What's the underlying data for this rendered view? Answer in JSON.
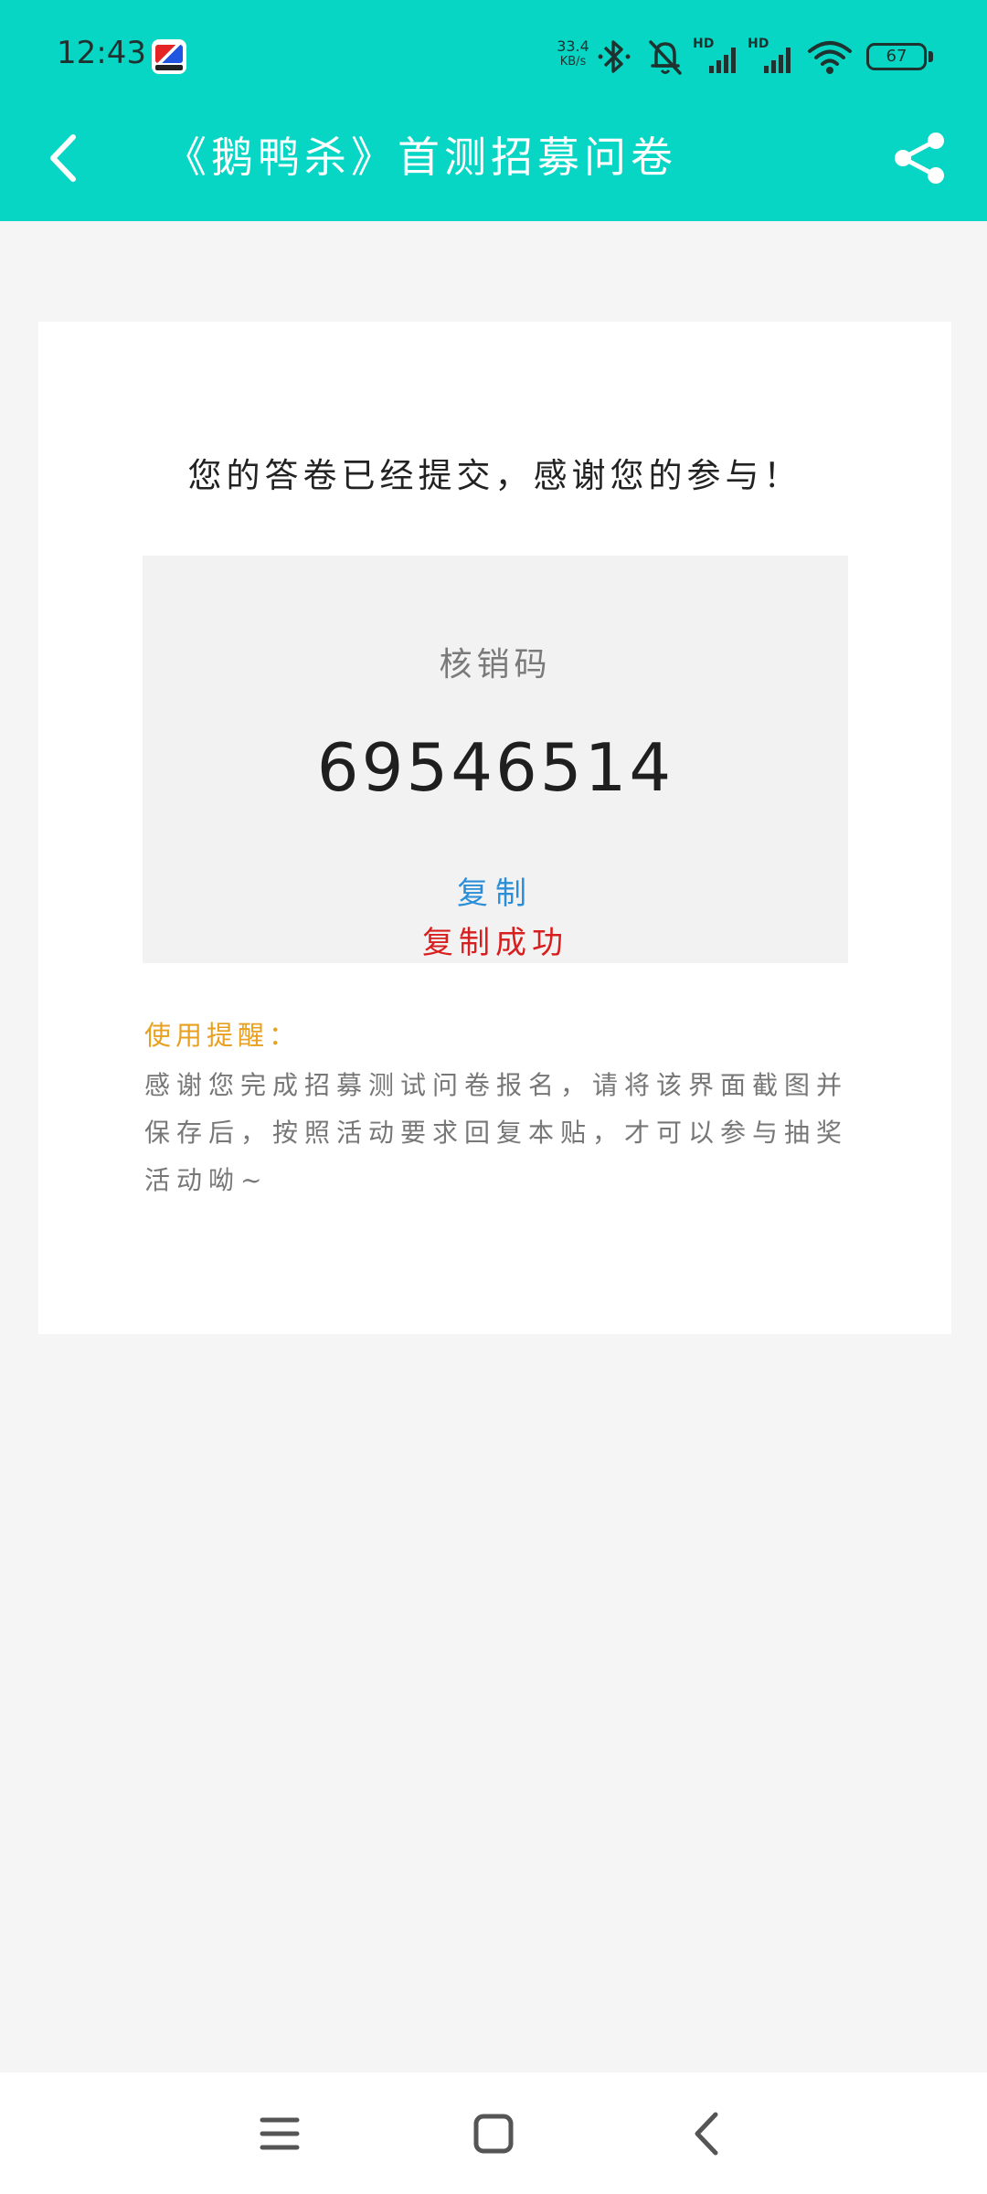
{
  "status_bar": {
    "time": "12:43",
    "network_speed_value": "33.4",
    "network_speed_unit": "KB/s",
    "battery_level": "67",
    "app_icon": "bilibili-comic-app-icon",
    "icons": [
      "bluetooth-icon",
      "mute-bell-icon",
      "hd-signal-icon",
      "hd-signal-icon",
      "wifi-icon",
      "battery-icon"
    ]
  },
  "header": {
    "title": "《鹅鸭杀》首测招募问卷",
    "back_icon": "chevron-left-icon",
    "share_icon": "share-icon",
    "background_color": "#07d6c5"
  },
  "card": {
    "thanks_message": "您的答卷已经提交，感谢您的参与！",
    "code_label": "核销码",
    "code_value": "69546514",
    "copy_label": "复制",
    "copy_success": "复制成功",
    "reminder_title": "使用提醒：",
    "reminder_text": "感谢您完成招募测试问卷报名，请将该界面截图并保存后，按照活动要求回复本贴，才可以参与抽奖活动呦~"
  },
  "colors": {
    "accent": "#07d6c5",
    "copy_link": "#2b8fd8",
    "success": "#d81f1f",
    "reminder_title": "#e8a020"
  },
  "bottom_nav": {
    "icons": [
      "menu-icon",
      "home-square-icon",
      "back-triangle-icon"
    ]
  }
}
